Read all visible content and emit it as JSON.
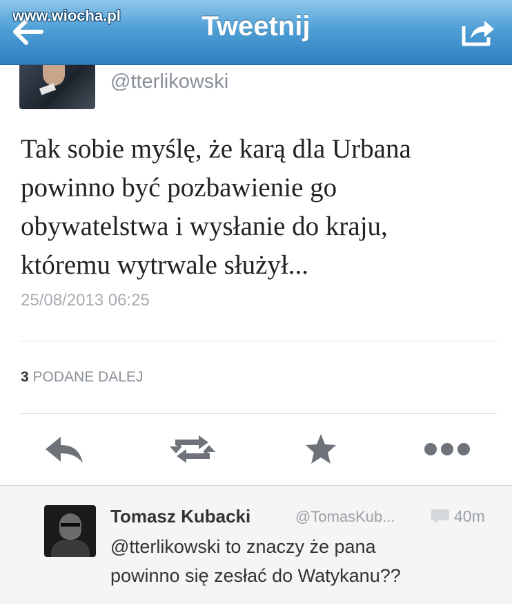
{
  "header": {
    "watermark": "www.wiocha.pl",
    "title": "Tweetnij",
    "back_icon": "back-arrow-icon",
    "share_icon": "share-icon"
  },
  "tweet": {
    "handle": "@tterlikowski",
    "text_lines": [
      "Tak sobie myślę, że karą dla Urbana",
      "powinno być pozbawienie go",
      "obywatelstwa i wysłanie do kraju,",
      "któremu wytrwale służył..."
    ],
    "timestamp": "25/08/2013 06:25",
    "retweet_count": "3",
    "retweet_label": "PODANE DALEJ"
  },
  "actions": {
    "reply_icon": "reply-icon",
    "retweet_icon": "retweet-icon",
    "favorite_icon": "star-icon",
    "more_icon": "more-icon"
  },
  "reply": {
    "name": "Tomasz Kubacki",
    "handle": "@TomasKub...",
    "time": "40m",
    "text_lines": [
      "@tterlikowski  to znaczy że pana",
      "powinno się zesłać do Watykanu??"
    ]
  },
  "colors": {
    "header_blue": "#3a8ccc",
    "icon_gray": "#6e737a"
  }
}
